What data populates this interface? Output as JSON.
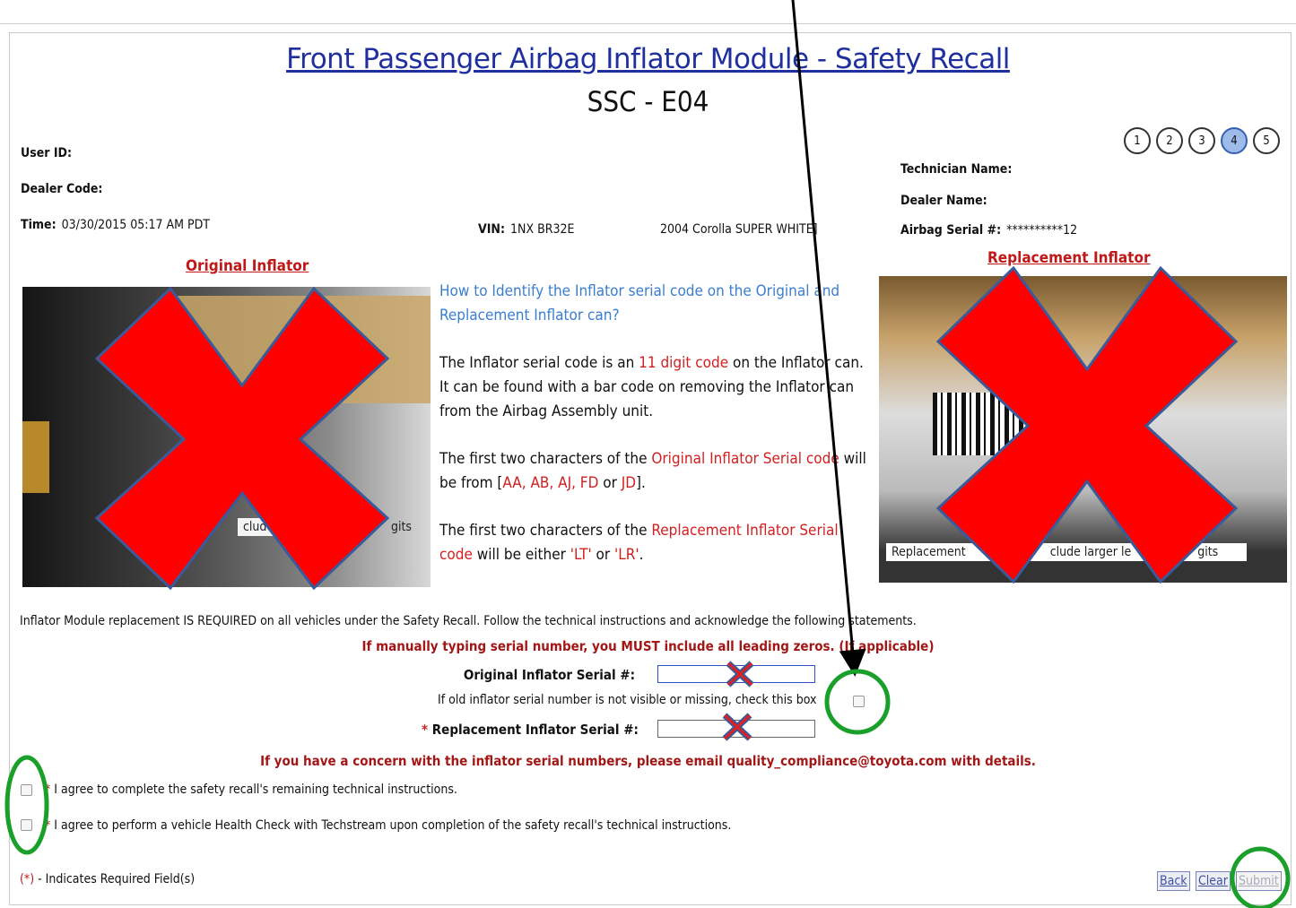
{
  "page": {
    "title": "Front Passenger Airbag Inflator Module - Safety Recall",
    "subtitle": "SSC - E04"
  },
  "steps": [
    {
      "label": "1",
      "active": false
    },
    {
      "label": "2",
      "active": false
    },
    {
      "label": "3",
      "active": false
    },
    {
      "label": "4",
      "active": true
    },
    {
      "label": "5",
      "active": false
    }
  ],
  "info": {
    "user_id_label": "User ID:",
    "dealer_code_label": "Dealer Code:",
    "time_label": "Time:",
    "time_value": "03/30/2015 05:17 AM PDT",
    "vin_label": "VIN:",
    "vin_value": "1NX BR32E",
    "vehicle": "2004 Corolla SUPER WHITE]",
    "technician_label": "Technician Name:",
    "dealer_name_label": "Dealer Name:",
    "airbag_serial_label": "Airbag Serial #:",
    "airbag_serial_value": "**********12"
  },
  "original": {
    "heading": "Original Inflator",
    "caption_left": "clude",
    "caption_right": "gits"
  },
  "replacement": {
    "heading": "Replacement Inflator",
    "caption_left": "Replacement",
    "caption_mid": "clude larger le",
    "caption_right": "gits"
  },
  "howto": {
    "question": "How to Identify the Inflator serial code on the Original and Replacement Inflator can?",
    "p1_a": "The Inflator serial code is an ",
    "p1_red": "11 digit code",
    "p1_b": " on the Inflator can. It can be found with a bar code on removing the Inflator can from the Airbag Assembly unit.",
    "p2_a": "The first two characters of the ",
    "p2_red": "Original Inflator Serial code",
    "p2_b": " will be from [",
    "p2_codes": "AA, AB, AJ, FD",
    "p2_or": " or ",
    "p2_last": "JD",
    "p2_end": "].",
    "p3_a": "The first two characters of the ",
    "p3_red": "Replacement Inflator Serial code",
    "p3_b": " will be either ",
    "p3_lt": "'LT'",
    "p3_or": " or ",
    "p3_lr": "'LR'",
    "p3_end": "."
  },
  "form": {
    "required_text": "Inflator Module replacement IS REQUIRED on all vehicles under the Safety Recall. Follow the technical instructions and acknowledge the following statements.",
    "warning_zeros": "If manually typing serial number, you MUST include all leading zeros. (If applicable)",
    "original_serial_label": "Original Inflator Serial #:",
    "original_serial_value": "",
    "missing_text": "If old inflator serial number is not visible or missing, check this box",
    "replacement_serial_label": "Replacement Inflator Serial #:",
    "replacement_serial_value": "",
    "required_marker": "*",
    "concern_text": "If you have a concern with the inflator serial numbers, please email quality_compliance@toyota.com with details.",
    "agree1": "I agree to complete the safety recall's remaining technical instructions.",
    "agree2": "I agree to perform a vehicle Health Check with Techstream upon completion of the safety recall's technical instructions.",
    "legend_star": "(*)",
    "legend_text": " - Indicates Required Field(s)"
  },
  "buttons": {
    "back": "Back",
    "clear": "Clear",
    "submit": "Submit"
  },
  "colors": {
    "annotation_green": "#1aa02a",
    "cross_red": "#ff0000",
    "cross_outline": "#3a5a9a",
    "link_blue": "#1f2f9e",
    "warning_red": "#a31616"
  }
}
